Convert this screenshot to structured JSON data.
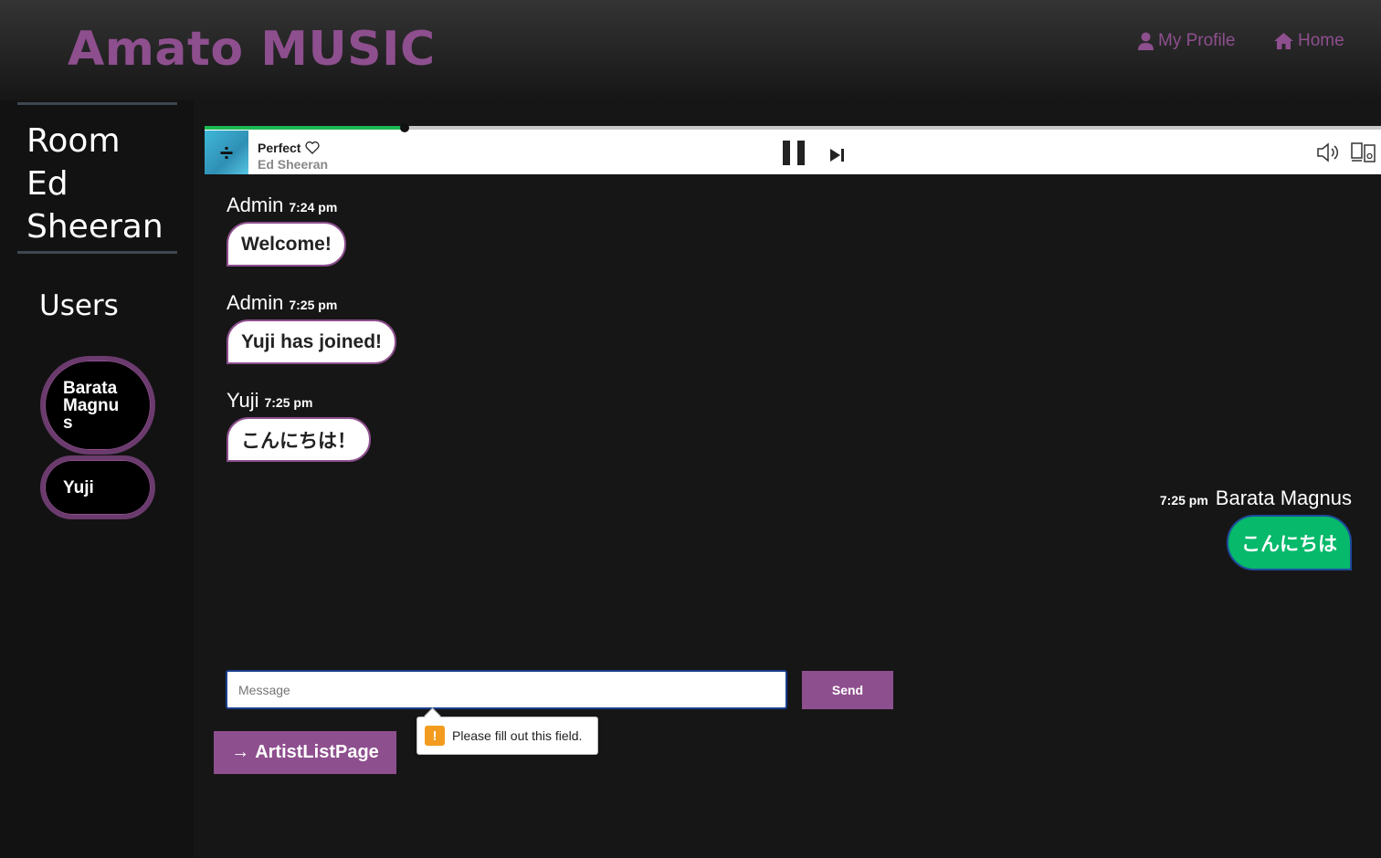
{
  "header": {
    "brand": "Amato MUSIC",
    "nav": [
      {
        "label": "My Profile",
        "icon": "user-icon"
      },
      {
        "label": "Home",
        "icon": "home-icon"
      }
    ],
    "accent_color": "#8e4f8e"
  },
  "sidebar": {
    "room_lines": [
      "Room",
      "Ed",
      "Sheeran"
    ],
    "users_title": "Users",
    "users": [
      "Barata Magnus",
      "Yuji"
    ]
  },
  "player": {
    "track_title": "Perfect",
    "artist": "Ed Sheeran",
    "progress": 0.17,
    "progress_color": "#1db954",
    "controls": [
      "heart-icon",
      "pause-icon",
      "skip-next-icon",
      "volume-icon",
      "devices-icon"
    ]
  },
  "messages": [
    {
      "author": "Admin",
      "time": "7:24 pm",
      "text": "Welcome!"
    },
    {
      "author": "Admin",
      "time": "7:25 pm",
      "text": "Yuji has joined!"
    },
    {
      "author": "Yuji",
      "time": "7:25 pm",
      "text": "こんにちは！"
    },
    {
      "author": "Barata Magnus",
      "time": "7:25 pm",
      "text": "こんにちは",
      "mine": true
    }
  ],
  "composer": {
    "placeholder": "Message",
    "send_label": "Send",
    "validation_message": "Please fill out this field."
  },
  "footer": {
    "artist_list_label": "ArtistListPage",
    "arrow": "→"
  }
}
